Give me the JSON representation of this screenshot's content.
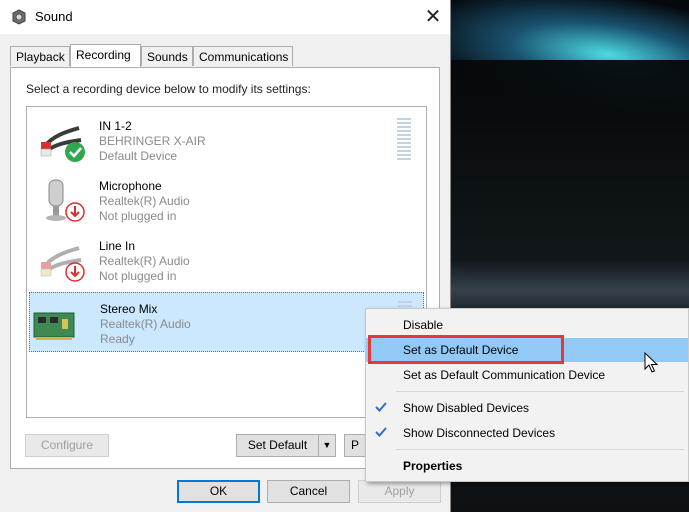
{
  "window": {
    "title": "Sound",
    "close": "✕"
  },
  "tabs": [
    {
      "label": "Playback",
      "active": false
    },
    {
      "label": "Recording",
      "active": true
    },
    {
      "label": "Sounds",
      "active": false
    },
    {
      "label": "Communications",
      "active": false
    }
  ],
  "instruction": "Select a recording device below to modify its settings:",
  "devices": [
    {
      "name": "IN 1-2",
      "line1": "BEHRINGER X-AIR",
      "line2": "Default Device",
      "icon": "rca-cable-icon",
      "status": "default-check"
    },
    {
      "name": "Microphone",
      "line1": "Realtek(R) Audio",
      "line2": "Not plugged in",
      "icon": "microphone-icon",
      "status": "unplugged"
    },
    {
      "name": "Line In",
      "line1": "Realtek(R) Audio",
      "line2": "Not plugged in",
      "icon": "rca-cable-icon",
      "status": "unplugged"
    },
    {
      "name": "Stereo Mix",
      "line1": "Realtek(R) Audio",
      "line2": "Ready",
      "icon": "sound-card-icon",
      "status": "selected"
    }
  ],
  "buttons": {
    "configure": "Configure",
    "set_default": "Set Default",
    "properties_partial": "P",
    "ok": "OK",
    "cancel": "Cancel",
    "apply": "Apply"
  },
  "context_menu": {
    "items": [
      {
        "label": "Disable"
      },
      {
        "label": "Set as Default Device",
        "highlighted": true
      },
      {
        "label": "Set as Default Communication Device"
      },
      {
        "label": "Show Disabled Devices",
        "checked": true
      },
      {
        "label": "Show Disconnected Devices",
        "checked": true
      },
      {
        "label": "Properties",
        "bold": true
      }
    ]
  },
  "colors": {
    "selection": "#cce8ff",
    "menu_hover": "#91c9f7",
    "highlight_box": "#e53935",
    "accent": "#0078d7"
  }
}
